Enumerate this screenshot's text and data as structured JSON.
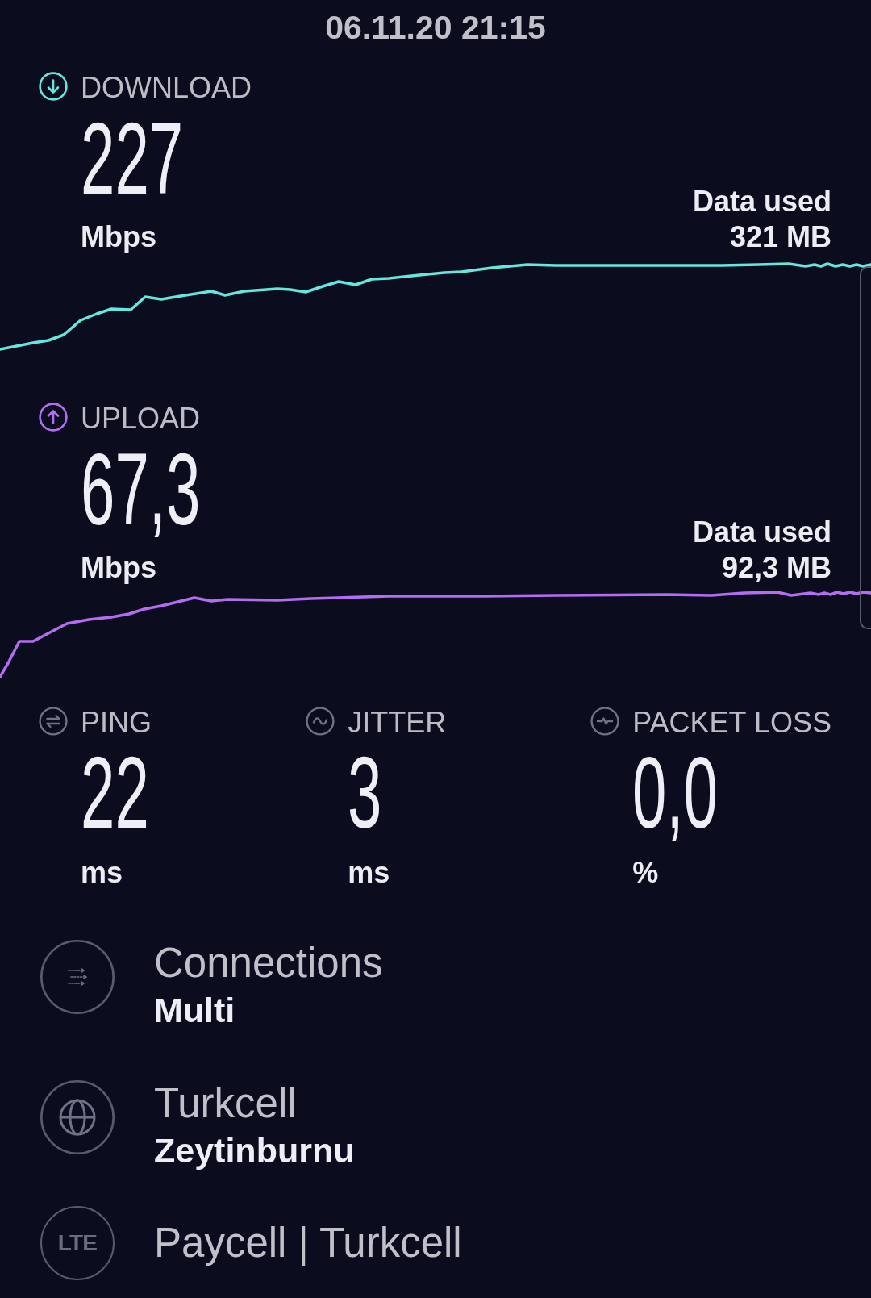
{
  "timestamp": "06.11.20 21:15",
  "speeds": [
    {
      "kind": "download",
      "label": "DOWNLOAD",
      "value": "227",
      "unit": "Mbps",
      "data_label": "Data used",
      "data_value": "321 MB",
      "color": "#66e6de"
    },
    {
      "kind": "upload",
      "label": "UPLOAD",
      "value": "67,3",
      "unit": "Mbps",
      "data_label": "Data used",
      "data_value": "92,3 MB",
      "color": "#b46cf0"
    }
  ],
  "metrics": [
    {
      "kind": "ping",
      "label": "PING",
      "value": "22",
      "unit": "ms"
    },
    {
      "kind": "jitter",
      "label": "JITTER",
      "value": "3",
      "unit": "ms"
    },
    {
      "kind": "packet_loss",
      "label": "PACKET LOSS",
      "value": "0,0",
      "unit": "%"
    }
  ],
  "details": [
    {
      "kind": "connections",
      "title": "Connections",
      "subtitle": "Multi"
    },
    {
      "kind": "server",
      "title": "Turkcell",
      "subtitle": "Zeytinburnu"
    },
    {
      "kind": "provider",
      "badge": "LTE",
      "title": "Paycell | Turkcell"
    }
  ]
}
